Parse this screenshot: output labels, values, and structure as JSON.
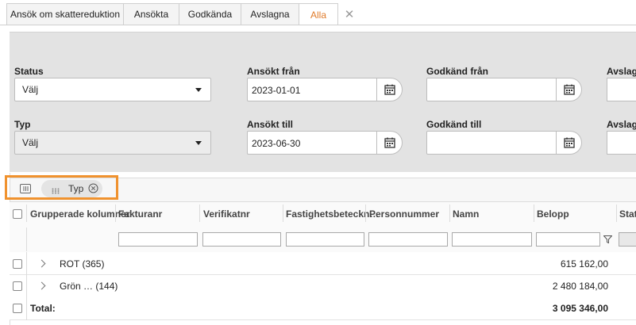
{
  "tabs": [
    {
      "label": "Ansök om skattereduktion"
    },
    {
      "label": "Ansökta"
    },
    {
      "label": "Godkända"
    },
    {
      "label": "Avslagna"
    },
    {
      "label": "Alla"
    }
  ],
  "close_glyph": "✕",
  "filters": {
    "status_label": "Status",
    "status_value": "Välj",
    "typ_label": "Typ",
    "typ_value": "Välj",
    "ansokt_fran_label": "Ansökt från",
    "ansokt_fran_value": "2023-01-01",
    "ansokt_till_label": "Ansökt till",
    "ansokt_till_value": "2023-06-30",
    "godkand_fran_label": "Godkänd från",
    "godkand_till_label": "Godkänd till",
    "avslagen_fran_label": "Avslage",
    "avslagen_till_label": "Avslage"
  },
  "groupbar": {
    "chip_label": "Typ"
  },
  "columns": [
    "Grupperade kolumner",
    "Fakturanr",
    "Verifikatnr",
    "Fastighetsbeteckn…",
    "Personnummer",
    "Namn",
    "Belopp",
    "Statu"
  ],
  "rows": [
    {
      "label": "ROT (365)",
      "amount": "615 162,00"
    },
    {
      "label": "Grön … (144)",
      "amount": "2 480 184,00"
    }
  ],
  "total": {
    "label": "Total:",
    "amount": "3 095 346,00"
  },
  "colors": {
    "accent": "#e07b2a",
    "highlight": "#f0922e",
    "panel": "#e3e3e3"
  }
}
